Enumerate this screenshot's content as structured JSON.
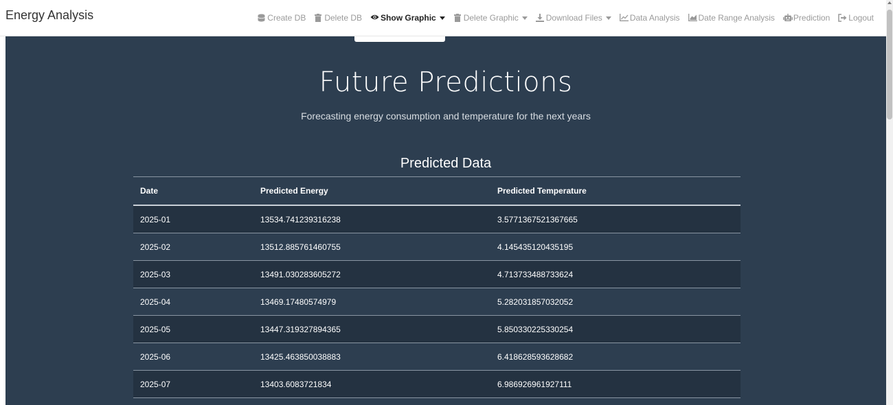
{
  "brand": "Energy Analysis",
  "nav": {
    "create_db": "Create DB",
    "delete_db": "Delete DB",
    "show_graphic": "Show Graphic",
    "delete_graphic": "Delete Graphic",
    "download_files": "Download Files",
    "data_analysis": "Data Analysis",
    "date_range_analysis": "Date Range Analysis",
    "prediction": "Prediction",
    "logout": "Logout"
  },
  "hero": {
    "title": "Future Predictions",
    "subtitle": "Forecasting energy consumption and temperature for the next years"
  },
  "table": {
    "title": "Predicted Data",
    "headers": [
      "Date",
      "Predicted Energy",
      "Predicted Temperature"
    ],
    "rows": [
      [
        "2025-01",
        "13534.741239316238",
        "3.5771367521367665"
      ],
      [
        "2025-02",
        "13512.885761460755",
        "4.145435120435195"
      ],
      [
        "2025-03",
        "13491.030283605272",
        "4.713733488733624"
      ],
      [
        "2025-04",
        "13469.17480574979",
        "5.282031857032052"
      ],
      [
        "2025-05",
        "13447.319327894365",
        "5.850330225330254"
      ],
      [
        "2025-06",
        "13425.463850038883",
        "6.418628593628682"
      ],
      [
        "2025-07",
        "13403.6083721834",
        "6.986926961927111"
      ]
    ]
  },
  "colors": {
    "panel": "#2d3e50",
    "stripe": "#243241",
    "nav_text": "#9a9a9a"
  }
}
